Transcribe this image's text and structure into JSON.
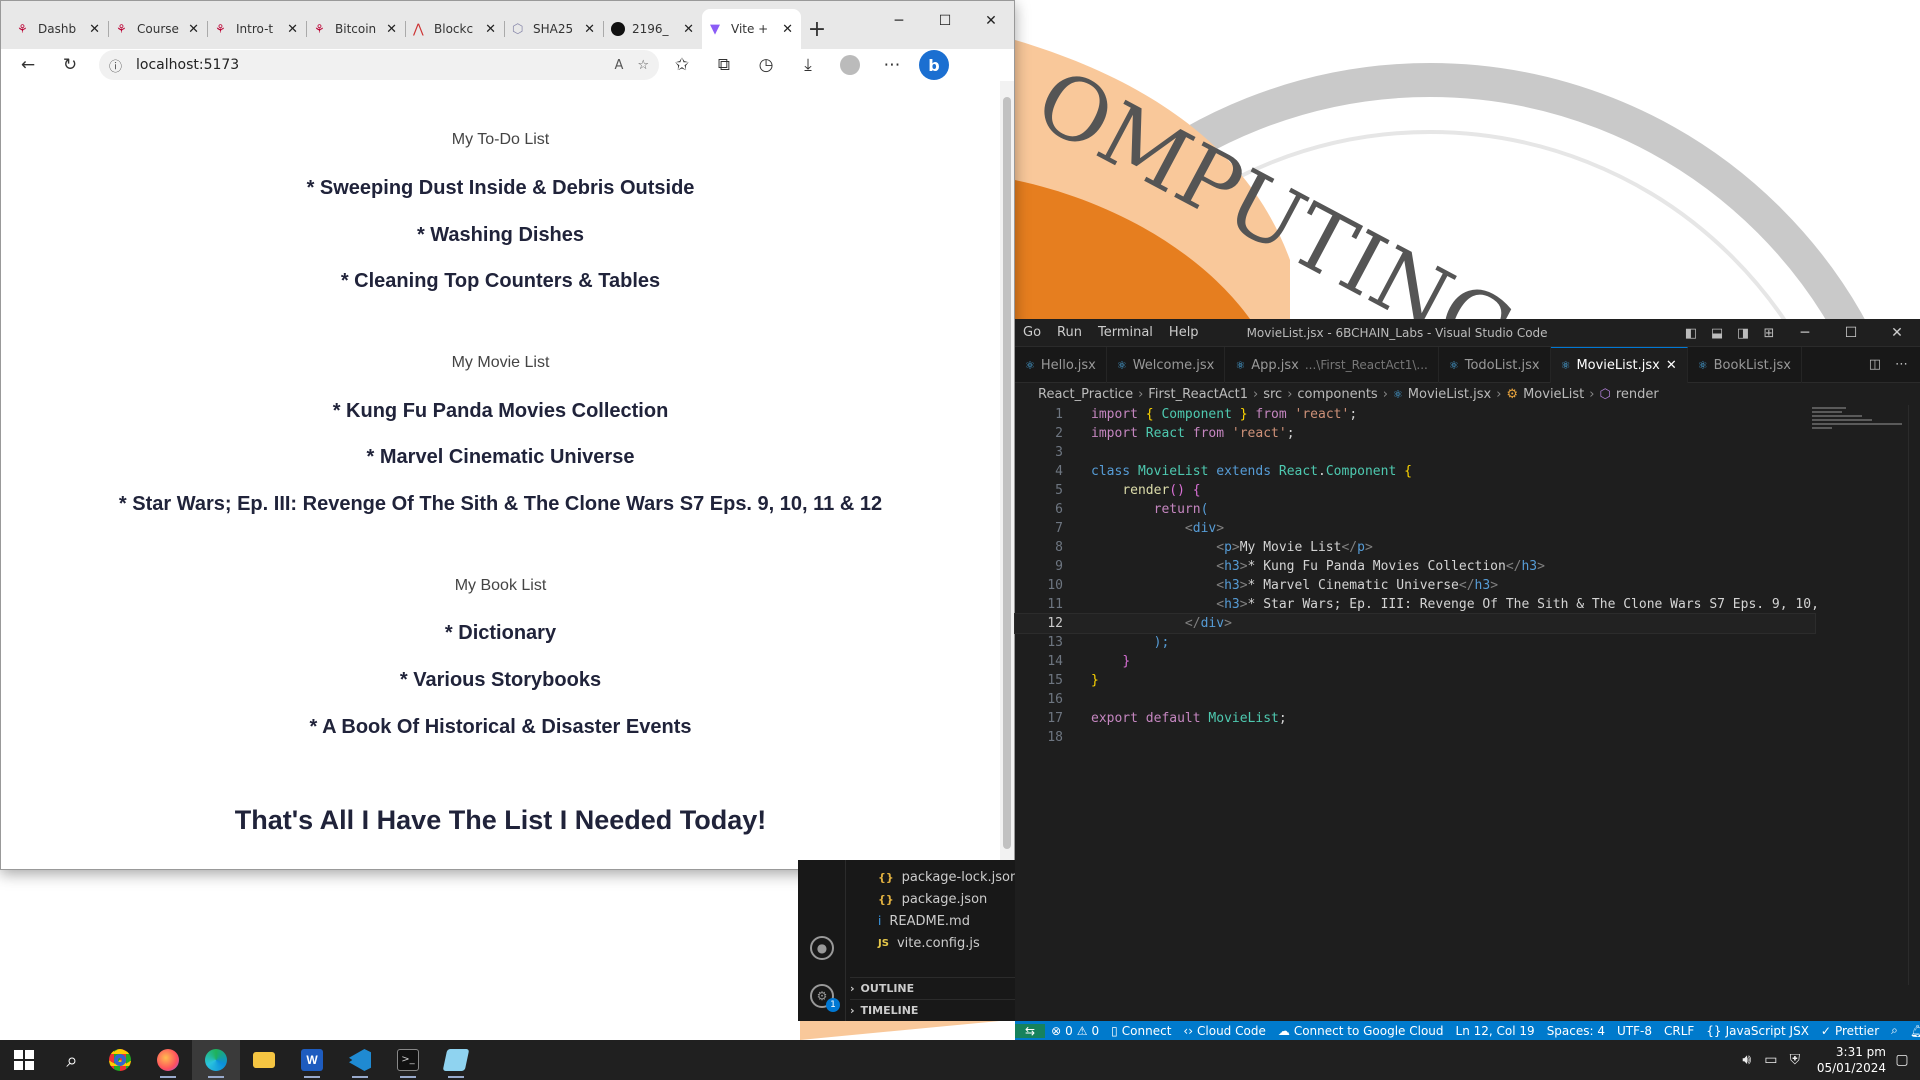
{
  "browser": {
    "tabs": [
      {
        "title": "Dashb",
        "active": false
      },
      {
        "title": "Course",
        "active": false
      },
      {
        "title": "Intro-t",
        "active": false
      },
      {
        "title": "Bitcoin",
        "active": false
      },
      {
        "title": "Blockc",
        "active": false
      },
      {
        "title": "SHA25",
        "active": false
      },
      {
        "title": "2196_",
        "active": false
      },
      {
        "title": "Vite +",
        "active": true
      }
    ],
    "url": "localhost:5173"
  },
  "page": {
    "todo": {
      "heading": "My To-Do List",
      "items": [
        "* Sweeping Dust Inside & Debris Outside",
        "* Washing Dishes",
        "* Cleaning Top Counters & Tables"
      ]
    },
    "movies": {
      "heading": "My Movie List",
      "items": [
        "* Kung Fu Panda Movies Collection",
        "* Marvel Cinematic Universe",
        "* Star Wars; Ep. III: Revenge Of The Sith & The Clone Wars S7 Eps. 9, 10, 11 & 12"
      ]
    },
    "books": {
      "heading": "My Book List",
      "items": [
        "* Dictionary",
        "* Various Storybooks",
        "* A Book Of Historical & Disaster Events"
      ]
    },
    "closing": "That's All I Have The List I Needed Today!"
  },
  "vscode": {
    "menu": [
      "Go",
      "Run",
      "Terminal",
      "Help"
    ],
    "window_title": "MovieList.jsx - 6BCHAIN_Labs - Visual Studio Code",
    "tabs": [
      {
        "label": "Hello.jsx",
        "extra": "",
        "active": false
      },
      {
        "label": "Welcome.jsx",
        "extra": "",
        "active": false
      },
      {
        "label": "App.jsx",
        "extra": "...\\First_ReactAct1\\...",
        "active": false
      },
      {
        "label": "TodoList.jsx",
        "extra": "",
        "active": false
      },
      {
        "label": "MovieList.jsx",
        "extra": "",
        "active": true
      },
      {
        "label": "BookList.jsx",
        "extra": "",
        "active": false
      }
    ],
    "breadcrumb": [
      "React_Practice",
      "First_ReactAct1",
      "src",
      "components",
      "MovieList.jsx",
      "MovieList",
      "render"
    ],
    "line_numbers": [
      "1",
      "2",
      "3",
      "4",
      "5",
      "6",
      "7",
      "8",
      "9",
      "10",
      "11",
      "12",
      "13",
      "14",
      "15",
      "16",
      "17",
      "18"
    ],
    "current_line": "12",
    "code": {
      "l1": [
        "import",
        " { ",
        "Component",
        " } ",
        "from",
        " ",
        "'react'",
        ";"
      ],
      "l2": [
        "import",
        " ",
        "React",
        " ",
        "from",
        " ",
        "'react'",
        ";"
      ],
      "l4": [
        "class",
        " ",
        "MovieList",
        " ",
        "extends",
        " ",
        "React",
        ".",
        "Component",
        " ",
        "{"
      ],
      "l5": [
        "render",
        "()",
        " ",
        "{"
      ],
      "l6": [
        "return",
        "("
      ],
      "l7": [
        "<",
        "div",
        ">"
      ],
      "l8": [
        "<",
        "p",
        ">",
        "My Movie List",
        "</",
        "p",
        ">"
      ],
      "l9": [
        "<",
        "h3",
        ">",
        "* Kung Fu Panda Movies Collection",
        "</",
        "h3",
        ">"
      ],
      "l10": [
        "<",
        "h3",
        ">",
        "* Marvel Cinematic Universe",
        "</",
        "h3",
        ">"
      ],
      "l11": [
        "<",
        "h3",
        ">",
        "* Star Wars; Ep. III: Revenge Of The Sith & The Clone Wars S7 Eps. 9, 10,"
      ],
      "l12": [
        "</",
        "div",
        ">"
      ],
      "l13": [
        ");"
      ],
      "l14": [
        "}"
      ],
      "l15": [
        "}"
      ],
      "l17": [
        "export",
        " ",
        "default",
        " ",
        "MovieList",
        ";"
      ]
    },
    "explorer_files": [
      {
        "icon": "{}",
        "name": "package-lock.json"
      },
      {
        "icon": "{}",
        "name": "package.json"
      },
      {
        "icon": "i",
        "name": "README.md"
      },
      {
        "icon": "JS",
        "name": "vite.config.js"
      }
    ],
    "sections": [
      "OUTLINE",
      "TIMELINE"
    ],
    "status_left": {
      "errors": "0",
      "warnings": "0",
      "connect": "Connect",
      "cloud_code": "Cloud Code",
      "google_cloud": "Connect to Google Cloud"
    },
    "status_right": [
      "Ln 12, Col 19",
      "Spaces: 4",
      "UTF-8",
      "CRLF",
      "JavaScript JSX",
      "Prettier"
    ],
    "settings_badge": "1"
  },
  "taskbar": {
    "apps": [
      "start",
      "search",
      "chrome",
      "firefox",
      "edge",
      "file-explorer",
      "word",
      "vscode",
      "terminal",
      "notepad"
    ],
    "time": "3:31 pm",
    "date": "05/01/2024"
  },
  "colors": {
    "vscode_status": "#007acc",
    "page_text": "#20233a",
    "edge_copilot": "#1b6fd1"
  },
  "icons": [
    "back-icon",
    "refresh-icon",
    "info-icon",
    "read-aloud-icon",
    "favorite-add-icon",
    "favorites-icon",
    "collections-icon",
    "history-icon",
    "download-icon",
    "profile-icon",
    "more-icon",
    "copilot-icon"
  ]
}
